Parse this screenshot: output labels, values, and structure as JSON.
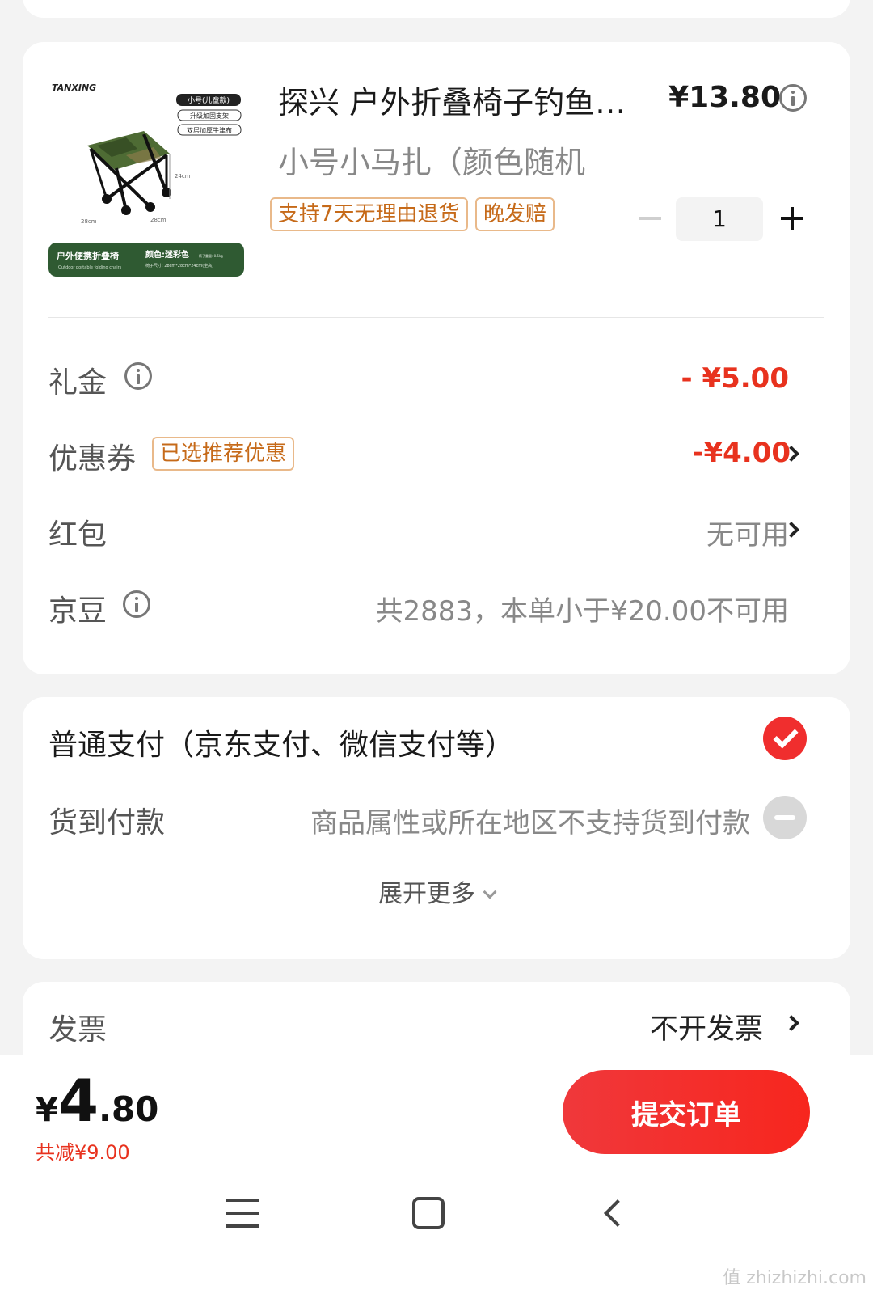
{
  "product": {
    "title": "探兴 户外折叠椅子钓鱼…",
    "spec": "小号小马扎（颜色随机",
    "price": "¥13.80",
    "tags": [
      "支持7天无理由退货",
      "晚发赔"
    ],
    "quantity": "1",
    "image": {
      "brand": "TANXING",
      "size_badge": "小号(儿童款)",
      "features": [
        "升级加固支架",
        "双层加厚牛津布"
      ],
      "dim_height": "24cm",
      "dim_width1": "28cm",
      "dim_width2": "28cm",
      "banner_name": "户外便携折叠椅",
      "banner_sub": "Outdoor portable folding chairs",
      "banner_color": "颜色:迷彩色",
      "banner_weight": "椅子重量: 0.5kg",
      "banner_size": "椅子尺寸: 28cm*28cm*24cm(坐高)"
    }
  },
  "discounts": {
    "gift": {
      "label": "礼金",
      "value": "- ¥5.00"
    },
    "coupon": {
      "label": "优惠券",
      "tag": "已选推荐优惠",
      "value": "-¥4.00"
    },
    "redpack": {
      "label": "红包",
      "value": "无可用"
    },
    "jingdou": {
      "label": "京豆",
      "value": "共2883，本单小于¥20.00不可用"
    }
  },
  "payment": {
    "normal": "普通支付（京东支付、微信支付等）",
    "cod_label": "货到付款",
    "cod_note": "商品属性或所在地区不支持货到付款",
    "expand": "展开更多"
  },
  "invoice": {
    "label": "发票",
    "value": "不开发票"
  },
  "footer": {
    "yen": "¥",
    "total_int": "4",
    "total_dec": ".80",
    "saved": "共减¥9.00",
    "submit": "提交订单"
  },
  "watermark": "值 zhizhizhi.com",
  "colors": {
    "accent": "#f02e2e",
    "discount_red": "#e8321e",
    "tag_orange": "#c66a19"
  }
}
